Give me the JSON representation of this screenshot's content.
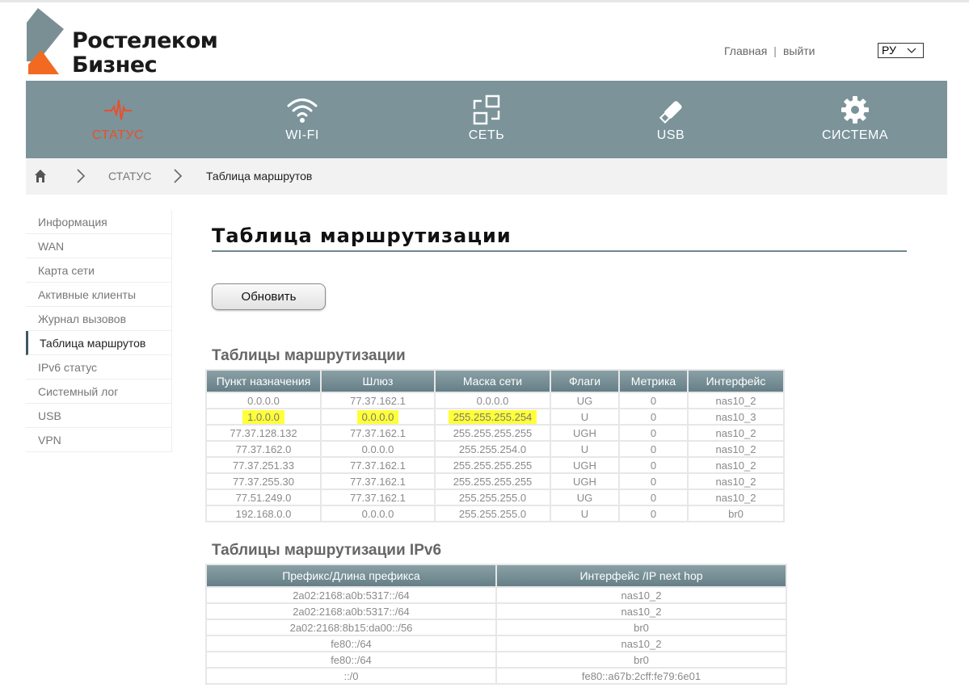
{
  "header": {
    "brand_line1": "Ростелеком",
    "brand_line2": "Бизнес",
    "link_home": "Главная",
    "separator": "|",
    "link_logout": "выйти",
    "language": "РУ"
  },
  "nav": {
    "items": [
      {
        "label": "СТАТУС",
        "icon": "pulse-icon",
        "active": true
      },
      {
        "label": "WI-FI",
        "icon": "wifi-icon",
        "active": false
      },
      {
        "label": "СЕТЬ",
        "icon": "network-icon",
        "active": false
      },
      {
        "label": "USB",
        "icon": "usb-icon",
        "active": false
      },
      {
        "label": "СИСТЕМА",
        "icon": "gear-icon",
        "active": false
      }
    ]
  },
  "breadcrumb": {
    "home_icon": "home-icon",
    "section": "СТАТУС",
    "page": "Таблица маршрутов"
  },
  "sidebar": {
    "items": [
      {
        "label": "Информация",
        "active": false
      },
      {
        "label": "WAN",
        "active": false
      },
      {
        "label": "Карта сети",
        "active": false
      },
      {
        "label": "Активные клиенты",
        "active": false
      },
      {
        "label": "Журнал вызовов",
        "active": false
      },
      {
        "label": "Таблица маршрутов",
        "active": true
      },
      {
        "label": "IPv6 статус",
        "active": false
      },
      {
        "label": "Системный лог",
        "active": false
      },
      {
        "label": "USB",
        "active": false
      },
      {
        "label": "VPN",
        "active": false
      }
    ]
  },
  "main": {
    "title": "Таблица маршрутизации",
    "refresh_label": "Обновить",
    "ipv4": {
      "title": "Таблицы маршрутизации",
      "columns": [
        "Пункт назначения",
        "Шлюз",
        "Маска сети",
        "Флаги",
        "Метрика",
        "Интерфейс"
      ],
      "rows": [
        [
          "0.0.0.0",
          "77.37.162.1",
          "0.0.0.0",
          "UG",
          "0",
          "nas10_2"
        ],
        [
          "1.0.0.0",
          "0.0.0.0",
          "255.255.255.254",
          "U",
          "0",
          "nas10_3"
        ],
        [
          "77.37.128.132",
          "77.37.162.1",
          "255.255.255.255",
          "UGH",
          "0",
          "nas10_2"
        ],
        [
          "77.37.162.0",
          "0.0.0.0",
          "255.255.254.0",
          "U",
          "0",
          "nas10_2"
        ],
        [
          "77.37.251.33",
          "77.37.162.1",
          "255.255.255.255",
          "UGH",
          "0",
          "nas10_2"
        ],
        [
          "77.37.255.30",
          "77.37.162.1",
          "255.255.255.255",
          "UGH",
          "0",
          "nas10_2"
        ],
        [
          "77.51.249.0",
          "77.37.162.1",
          "255.255.255.0",
          "UG",
          "0",
          "nas10_2"
        ],
        [
          "192.168.0.0",
          "0.0.0.0",
          "255.255.255.0",
          "U",
          "0",
          "br0"
        ]
      ],
      "highlighted_row": 1,
      "highlight_color": "#ffff3a"
    },
    "ipv6": {
      "title": "Таблицы маршрутизации IPv6",
      "columns": [
        "Префикс/Длина префикса",
        "Интерфейс /IP next hop"
      ],
      "rows": [
        [
          "2a02:2168:a0b:5317::/64",
          "nas10_2"
        ],
        [
          "2a02:2168:a0b:5317::/64",
          "nas10_2"
        ],
        [
          "2a02:2168:8b15:da00::/56",
          "br0"
        ],
        [
          "fe80::/64",
          "nas10_2"
        ],
        [
          "fe80::/64",
          "br0"
        ],
        [
          "::/0",
          "fe80::a67b:2cff:fe79:6e01"
        ]
      ]
    }
  },
  "colors": {
    "nav_bg": "#7b9399",
    "accent": "#e8502c",
    "table_header": "#74898f"
  }
}
